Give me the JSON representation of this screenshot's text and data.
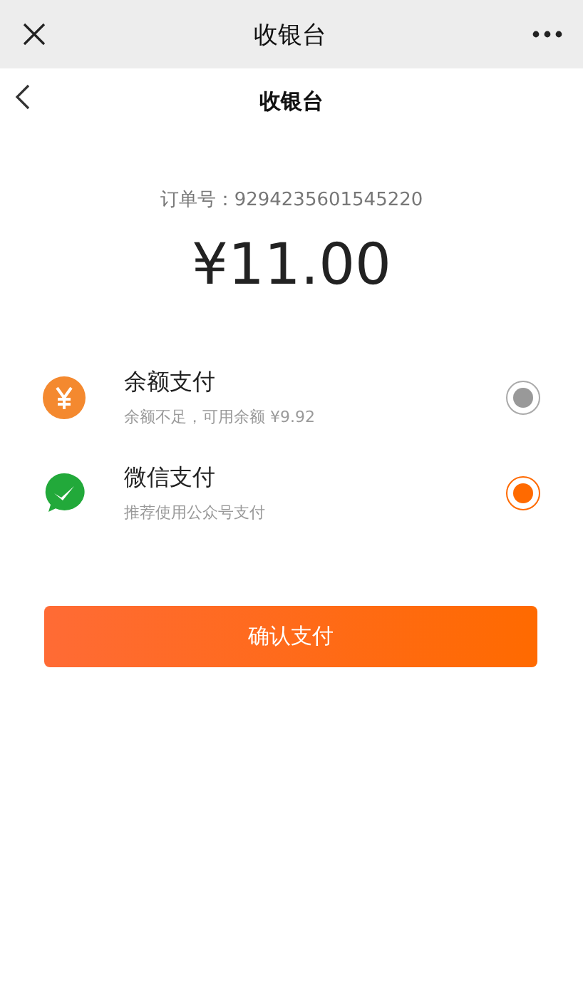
{
  "top_bar": {
    "title": "收银台"
  },
  "header": {
    "title": "收银台"
  },
  "order": {
    "label": "订单号：9294235601545220",
    "amount": "¥11.00"
  },
  "methods": [
    {
      "kind": "balance",
      "name": "余额支付",
      "note": "余额不足，可用余额 ¥9.92",
      "selected": false
    },
    {
      "kind": "wechat",
      "name": "微信支付",
      "note": "推荐使用公众号支付",
      "selected": true
    }
  ],
  "confirm_button": "确认支付"
}
